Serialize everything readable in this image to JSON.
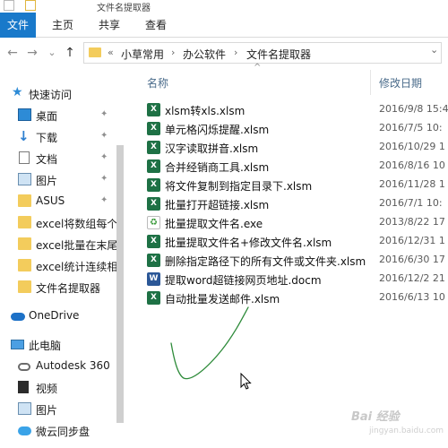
{
  "window": {
    "title": "文件名提取器"
  },
  "ribbon": {
    "tabs": [
      "文件",
      "主页",
      "共享",
      "查看"
    ]
  },
  "address": {
    "overflow_glyph": "«",
    "crumbs": [
      "小草常用",
      "办公软件",
      "文件名提取器"
    ],
    "separator": "›",
    "dropdown_glyph": "⌄"
  },
  "nav_glyphs": {
    "back": "←",
    "forward": "→",
    "recent": "⌄",
    "up": "↑"
  },
  "sidebar": {
    "quick_access": "快速访问",
    "quick_items": [
      {
        "label": "桌面",
        "icon": "desktop-icon",
        "pinned": true
      },
      {
        "label": "下载",
        "icon": "download-icon",
        "pinned": true
      },
      {
        "label": "文档",
        "icon": "documents-icon",
        "pinned": true
      },
      {
        "label": "图片",
        "icon": "pictures-icon",
        "pinned": true
      },
      {
        "label": "ASUS",
        "icon": "folder-icon",
        "pinned": true
      },
      {
        "label": "excel将数组每个",
        "icon": "folder-icon",
        "pinned": false
      },
      {
        "label": "excel批量在末尾",
        "icon": "folder-icon",
        "pinned": false
      },
      {
        "label": "excel统计连续相",
        "icon": "folder-icon",
        "pinned": false
      },
      {
        "label": "文件名提取器",
        "icon": "folder-icon",
        "pinned": false
      }
    ],
    "onedrive": "OneDrive",
    "this_pc": "此电脑",
    "pc_items": [
      {
        "label": "Autodesk 360",
        "icon": "autodesk-icon"
      },
      {
        "label": "视频",
        "icon": "video-icon"
      },
      {
        "label": "图片",
        "icon": "pictures-icon"
      },
      {
        "label": "微云同步盘",
        "icon": "weiyun-icon"
      }
    ],
    "pin_glyph": "✦"
  },
  "columns": {
    "name": "名称",
    "modified": "修改日期",
    "sort_glyph": "^"
  },
  "files": [
    {
      "name": "xlsm转xls.xlsm",
      "date": "2016/9/8 15:4",
      "type": "xl"
    },
    {
      "name": "单元格闪烁提醒.xlsm",
      "date": "2016/7/5 10:",
      "type": "xl"
    },
    {
      "name": "汉字读取拼音.xlsm",
      "date": "2016/10/29 1",
      "type": "xl"
    },
    {
      "name": "合并经销商工具.xlsm",
      "date": "2016/8/16 10",
      "type": "xl"
    },
    {
      "name": "将文件复制到指定目录下.xlsm",
      "date": "2016/11/28 1",
      "type": "xl"
    },
    {
      "name": "批量打开超链接.xlsm",
      "date": "2016/7/1 10:",
      "type": "xl"
    },
    {
      "name": "批量提取文件名.exe",
      "date": "2013/8/22 17",
      "type": "exe"
    },
    {
      "name": "批量提取文件名+修改文件名.xlsm",
      "date": "2016/12/31 1",
      "type": "xl"
    },
    {
      "name": "删除指定路径下的所有文件或文件夹.xlsm",
      "date": "2016/6/30 17",
      "type": "xl"
    },
    {
      "name": "提取word超链接网页地址.docm",
      "date": "2016/12/2 21",
      "type": "doc"
    },
    {
      "name": "自动批量发送邮件.xlsm",
      "date": "2016/6/13 10",
      "type": "xl"
    }
  ],
  "file_icon_glyphs": {
    "xl": "X",
    "exe": "♻",
    "doc": "W"
  },
  "watermark": {
    "main": "Bai 经验",
    "sub": "jingyan.baidu.com"
  },
  "colors": {
    "accent": "#1979ca",
    "folder": "#f3cc5c",
    "excel": "#1e7145",
    "word": "#2b5797",
    "scribble": "#2e8b3a"
  }
}
